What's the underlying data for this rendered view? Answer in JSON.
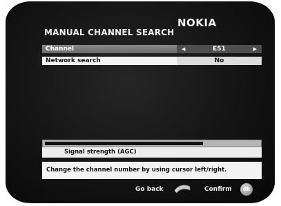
{
  "header": {
    "brand": "NOKIA",
    "title": "MANUAL CHANNEL SEARCH"
  },
  "menu": {
    "rows": [
      {
        "label": "Channel",
        "value": "E51",
        "selected": true
      },
      {
        "label": "Network search",
        "value": "No",
        "selected": false
      }
    ]
  },
  "signal": {
    "label": "Signal strength (AGC)",
    "level_fraction": 0.74
  },
  "help_text": "Change the channel number by using cursor left/right.",
  "footer": {
    "back_label": "Go back",
    "confirm_label": "Confirm",
    "ok_icon_text": "ok"
  },
  "icons": {
    "left_arrow": "left-arrow-icon",
    "right_arrow": "right-arrow-icon",
    "back": "back-arrow-icon",
    "ok": "ok-button-icon"
  }
}
